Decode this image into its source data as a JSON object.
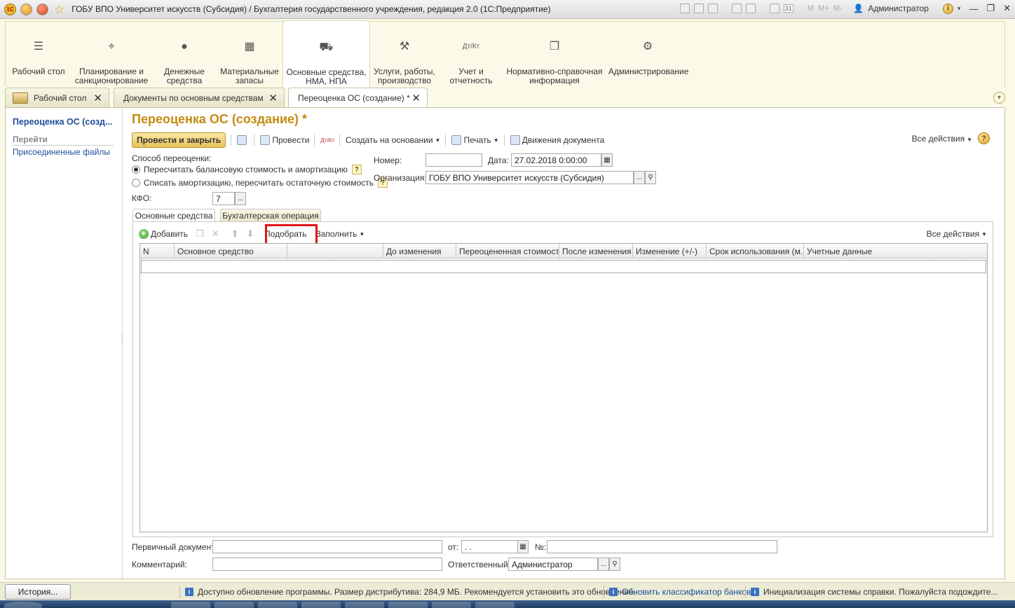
{
  "window": {
    "title": "ГОБУ ВПО Университет искусств (Субсидия) / Бухгалтерия государственного учреждения, редакция 2.0  (1С:Предприятие)",
    "logo_text": "1С",
    "m_buttons": [
      "M",
      "M+",
      "M-"
    ],
    "user": "Администратор",
    "calendar_day": "31"
  },
  "sections": [
    {
      "label": "Рабочий стол",
      "icon": "menu-icon"
    },
    {
      "label": "Планирование и санкционирование",
      "icon": "planning-icon"
    },
    {
      "label": "Денежные средства",
      "icon": "money-icon"
    },
    {
      "label": "Материальные запасы",
      "icon": "grid-icon"
    },
    {
      "label": "Основные средства, НМА, НПА",
      "icon": "truck-icon"
    },
    {
      "label": "Услуги, работы, производство",
      "icon": "tools-icon"
    },
    {
      "label": "Учет и отчетность",
      "icon": "dt-kt-icon"
    },
    {
      "label": "Нормативно-справочная информация",
      "icon": "documents-icon"
    },
    {
      "label": "Администрирование",
      "icon": "gear-icon"
    }
  ],
  "tabs": [
    {
      "label": "Рабочий стол"
    },
    {
      "label": "Документы по основным средствам"
    },
    {
      "label": "Переоценка ОС (создание) *"
    }
  ],
  "leftpane": {
    "title": "Переоценка ОС (созд...",
    "goto_label": "Перейти",
    "links": [
      "Присоединенные файлы"
    ]
  },
  "form": {
    "title": "Переоценка ОС (создание) *",
    "cmd": {
      "post_close": "Провести и закрыть",
      "post": "Провести",
      "create_based": "Создать на основании",
      "print": "Печать",
      "movements": "Движения документа",
      "all_actions": "Все действия",
      "help": "?"
    },
    "method_label": "Способ переоценки:",
    "method_options": [
      "Пересчитать балансовую стоимость и амортизацию",
      "Списать амортизацию, пересчитать остаточную стоимость"
    ],
    "kfo_label": "КФО:",
    "kfo_value": "7",
    "number_label": "Номер:",
    "number_value": "",
    "date_label": "Дата:",
    "date_value": "27.02.2018  0:00:00",
    "org_label": "Организация:",
    "org_value": "ГОБУ ВПО Университет искусств (Субсидия)",
    "inner_tabs": [
      "Основные средства",
      "Бухгалтерская операция"
    ],
    "table_cmd": {
      "add": "Добавить",
      "pick": "Подобрать",
      "fill": "Заполнить",
      "all_actions": "Все действия"
    },
    "columns": [
      "N",
      "Основное средство",
      "",
      "До изменения",
      "Переоцененная стоимость",
      "После изменения",
      "Изменение (+/-)",
      "Срок использования (м...",
      "Учетные данные"
    ],
    "primary_doc_label": "Первичный документ:",
    "primary_doc_value": "",
    "from_label": "от:",
    "from_value": " .  .",
    "no_label": "№:",
    "no_value": "",
    "comment_label": "Комментарий:",
    "comment_value": "",
    "responsible_label": "Ответственный:",
    "responsible_value": "Администратор"
  },
  "statusbar": {
    "history": "История...",
    "messages": [
      "Доступно обновление программы. Размер дистрибутива: 284,9 МБ. Рекомендуется установить это обновление.",
      "Обновить классификатор банков",
      "Инициализация системы справки. Пожалуйста подождите..."
    ]
  }
}
